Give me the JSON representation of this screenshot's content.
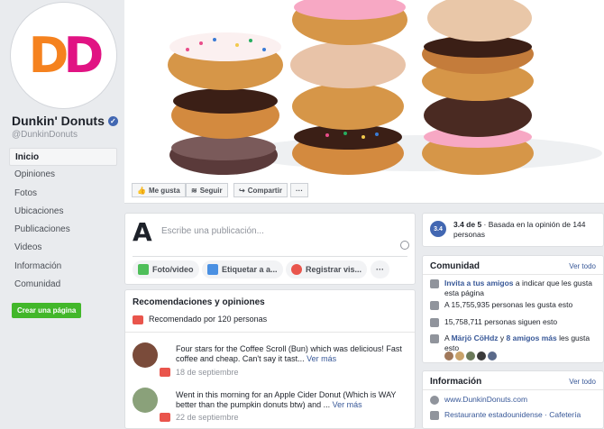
{
  "page": {
    "name": "Dunkin' Donuts",
    "handle": "@DunkinDonuts",
    "logo_text": "DD"
  },
  "nav": [
    "Inicio",
    "Opiniones",
    "Fotos",
    "Ubicaciones",
    "Publicaciones",
    "Videos",
    "Información",
    "Comunidad"
  ],
  "create_page_label": "Crear una página",
  "actions": {
    "like": "Me gusta",
    "follow": "Seguir",
    "share": "Compartir",
    "more": "···"
  },
  "composer": {
    "placeholder": "Escribe una publicación...",
    "photo": "Foto/video",
    "tag": "Etiquetar a a...",
    "checkin": "Registrar vis...",
    "more": "···"
  },
  "reviews": {
    "title": "Recomendaciones y opiniones",
    "recommended": "Recomendado por 120 personas",
    "items": [
      {
        "text": "Four stars for the Coffee Scroll (Bun) which was delicious! Fast coffee and cheap. Can't say it tast...",
        "more": "Ver más",
        "date": "18 de septiembre"
      },
      {
        "text": "Went in this morning for an Apple Cider Donut (Which is WAY better than the pumpkin donuts btw) and ...",
        "more": "Ver más",
        "date": "22 de septiembre"
      }
    ]
  },
  "rating": {
    "score": "3.4",
    "text_bold": "3.4 de 5",
    "text": " · Basada en la opinión de 144 personas"
  },
  "community": {
    "title": "Comunidad",
    "see_all": "Ver todo",
    "invite_link": "Invita a tus amigos",
    "invite_text": " a indicar que les gusta esta página",
    "likes": "A 15,755,935 personas les gusta esto",
    "follows": "15,758,711 personas siguen esto",
    "friends_prefix": "A ",
    "friend_name": "Märjö CöHdz",
    "friends_mid": " y ",
    "friends_more": "8 amigos más",
    "friends_suffix": " les gusta esto"
  },
  "info": {
    "title": "Información",
    "see_all": "Ver todo",
    "website": "www.DunkinDonuts.com",
    "category": "Restaurante estadounidense · Cafetería"
  },
  "colors": {
    "brand_orange": "#f5821f",
    "brand_pink": "#e11383",
    "fb_blue": "#4267b2",
    "green": "#42b72a"
  }
}
